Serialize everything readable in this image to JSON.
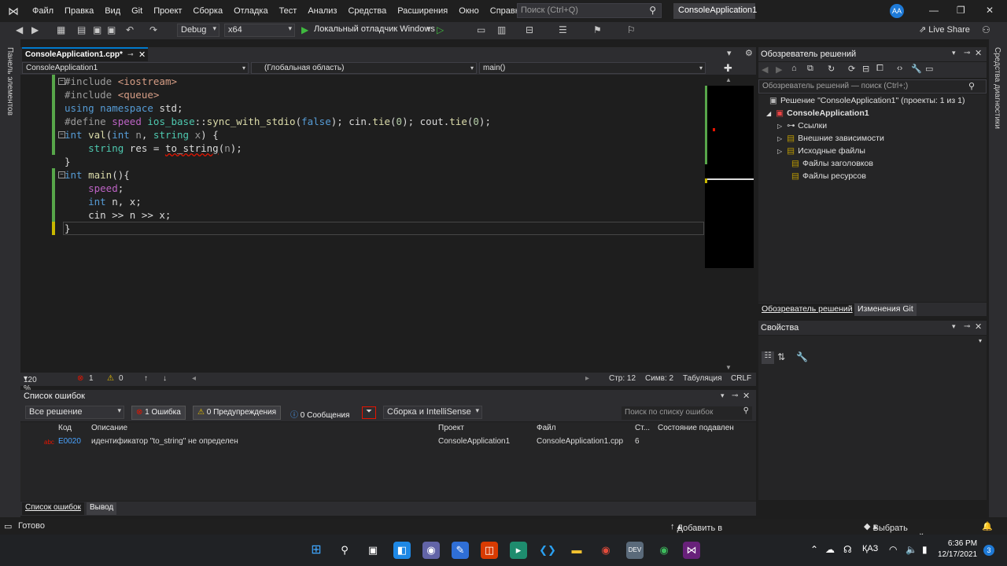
{
  "menubar": {
    "items": [
      "Файл",
      "Правка",
      "Вид",
      "Git",
      "Проект",
      "Сборка",
      "Отладка",
      "Тест",
      "Анализ",
      "Средства",
      "Расширения",
      "Окно",
      "Справка"
    ],
    "search_placeholder": "Поиск (Ctrl+Q)",
    "app_title": "ConsoleApplication1",
    "avatar_initials": "АА"
  },
  "toolbar": {
    "configuration": "Debug",
    "platform": "x64",
    "run_label": "Локальный отладчик Windows",
    "live_share": "Live Share"
  },
  "left_strip": {
    "label": "Панель элементов"
  },
  "right_strip": {
    "label": "Средства диагностики"
  },
  "editor": {
    "tab_label": "ConsoleApplication1.cpp*",
    "nav_project": "ConsoleApplication1",
    "nav_scope": "(Глобальная область)",
    "nav_member": "main()",
    "zoom": "120 %",
    "errors": "1",
    "warnings": "0",
    "line": "Стр: 12",
    "col": "Симв: 2",
    "indent": "Табуляция",
    "eol": "CRLF",
    "code_lines": [
      "#include <iostream>",
      "#include <queue>",
      "using namespace std;",
      "#define speed ios_base::sync_with_stdio(false); cin.tie(0); cout.tie(0);",
      "int val(int n, string x) {",
      "    string res = to_string(n);",
      "}",
      "int main(){",
      "    speed;",
      "    int n, x;",
      "    cin >> n >> x;",
      "}"
    ]
  },
  "error_list": {
    "title": "Список ошибок",
    "scope": "Все решение",
    "errors_btn": "1 Ошибка",
    "warnings_btn": "0 Предупреждения",
    "messages_btn": "0 Сообщения",
    "build_filter": "Сборка и IntelliSense",
    "search_placeholder": "Поиск по списку ошибок",
    "columns": [
      "Код",
      "Описание",
      "Проект",
      "Файл",
      "Ст...",
      "Состояние подавлен"
    ],
    "rows": [
      {
        "code": "E0020",
        "description": "идентификатор \"to_string\" не определен",
        "project": "ConsoleApplication1",
        "file": "ConsoleApplication1.cpp",
        "line": "6",
        "state": ""
      }
    ]
  },
  "bottom_tabs": [
    "Список ошибок",
    "Вывод"
  ],
  "solution_explorer": {
    "title": "Обозреватель решений",
    "search_placeholder": "Обозреватель решений — поиск (Ctrl+;)",
    "solution": "Решение \"ConsoleApplication1\" (проекты: 1 из 1)",
    "project": "ConsoleApplication1",
    "nodes": [
      "Ссылки",
      "Внешние зависимости",
      "Исходные файлы",
      "Файлы заголовков",
      "Файлы ресурсов"
    ],
    "tabs": [
      "Обозреватель решений",
      "Изменения Git"
    ]
  },
  "properties": {
    "title": "Свойства"
  },
  "statusbar": {
    "ready": "Готово",
    "add_to_vcs": "Добавить в систему управления версиями",
    "select_repo": "Выбрать репозиторий"
  },
  "taskbar": {
    "lang": "ҚАЗ",
    "time": "6:36 PM",
    "date": "12/17/2021",
    "notifications": "3"
  },
  "colors": {
    "accent": "#007acc",
    "error": "#e51400",
    "background": "#1e1e1e"
  }
}
